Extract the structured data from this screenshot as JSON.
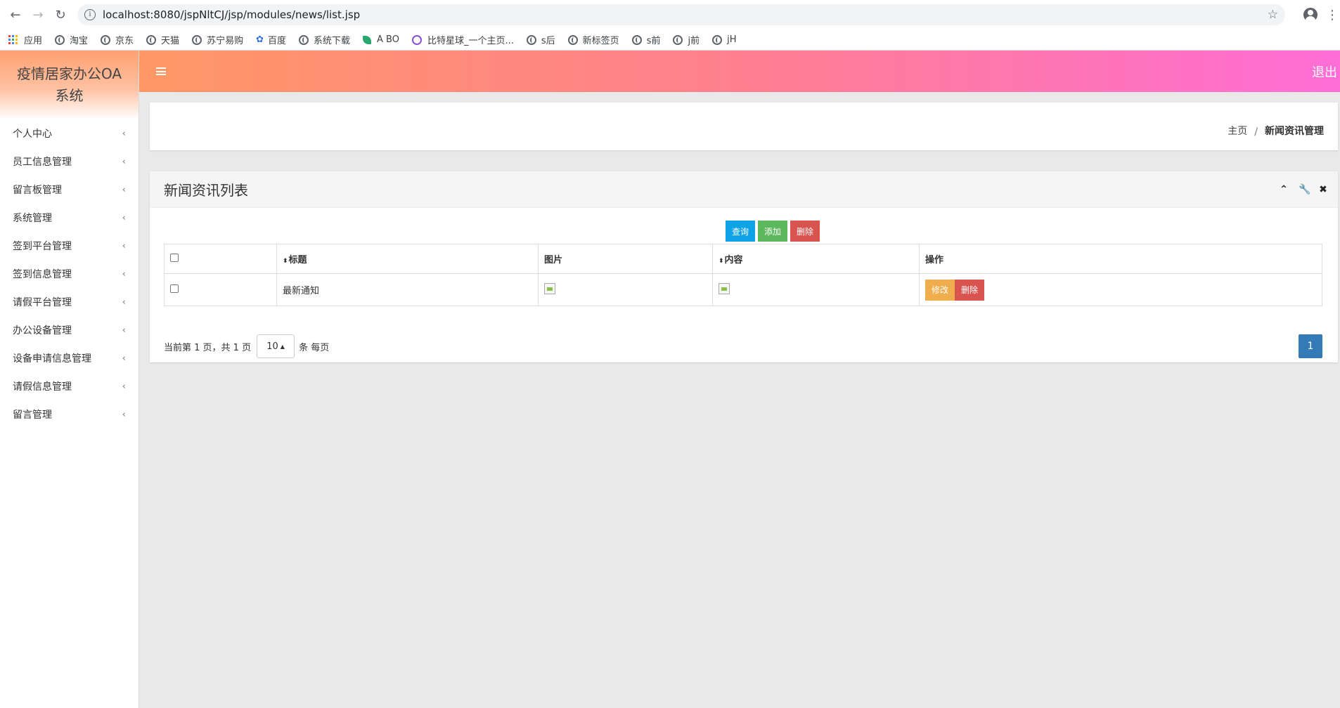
{
  "browser": {
    "url": "localhost:8080/jspNltCJ/jsp/modules/news/list.jsp",
    "bookmarks": [
      "应用",
      "淘宝",
      "京东",
      "天猫",
      "苏宁易购",
      "百度",
      "系统下载",
      "A BO",
      "比特星球_一个主页...",
      "s后",
      "新标签页",
      "s前",
      "j前",
      "jH"
    ]
  },
  "app": {
    "title": "疫情居家办公OA系统",
    "logout_label": "退出",
    "accent_colors": {
      "header_start": "#ff9865",
      "header_end": "#ff6ed7"
    }
  },
  "sidebar": {
    "items": [
      {
        "label": "个人中心"
      },
      {
        "label": "员工信息管理"
      },
      {
        "label": "留言板管理"
      },
      {
        "label": "系统管理"
      },
      {
        "label": "签到平台管理"
      },
      {
        "label": "签到信息管理"
      },
      {
        "label": "请假平台管理"
      },
      {
        "label": "办公设备管理"
      },
      {
        "label": "设备申请信息管理"
      },
      {
        "label": "请假信息管理"
      },
      {
        "label": "留言管理"
      }
    ]
  },
  "breadcrumb": {
    "home": "主页",
    "current": "新闻资讯管理"
  },
  "panel": {
    "title": "新闻资讯列表",
    "buttons": {
      "search": "查询",
      "add": "添加",
      "delete": "删除"
    },
    "table": {
      "columns": [
        "标题",
        "图片",
        "内容",
        "操作"
      ],
      "rows": [
        {
          "title": "最新通知",
          "edit_label": "修改",
          "delete_label": "删除"
        }
      ]
    },
    "pager": {
      "summary": "当前第 1 页，共 1 页",
      "page_size": "10",
      "per_page_label": "条 每页",
      "current_page": "1"
    }
  }
}
